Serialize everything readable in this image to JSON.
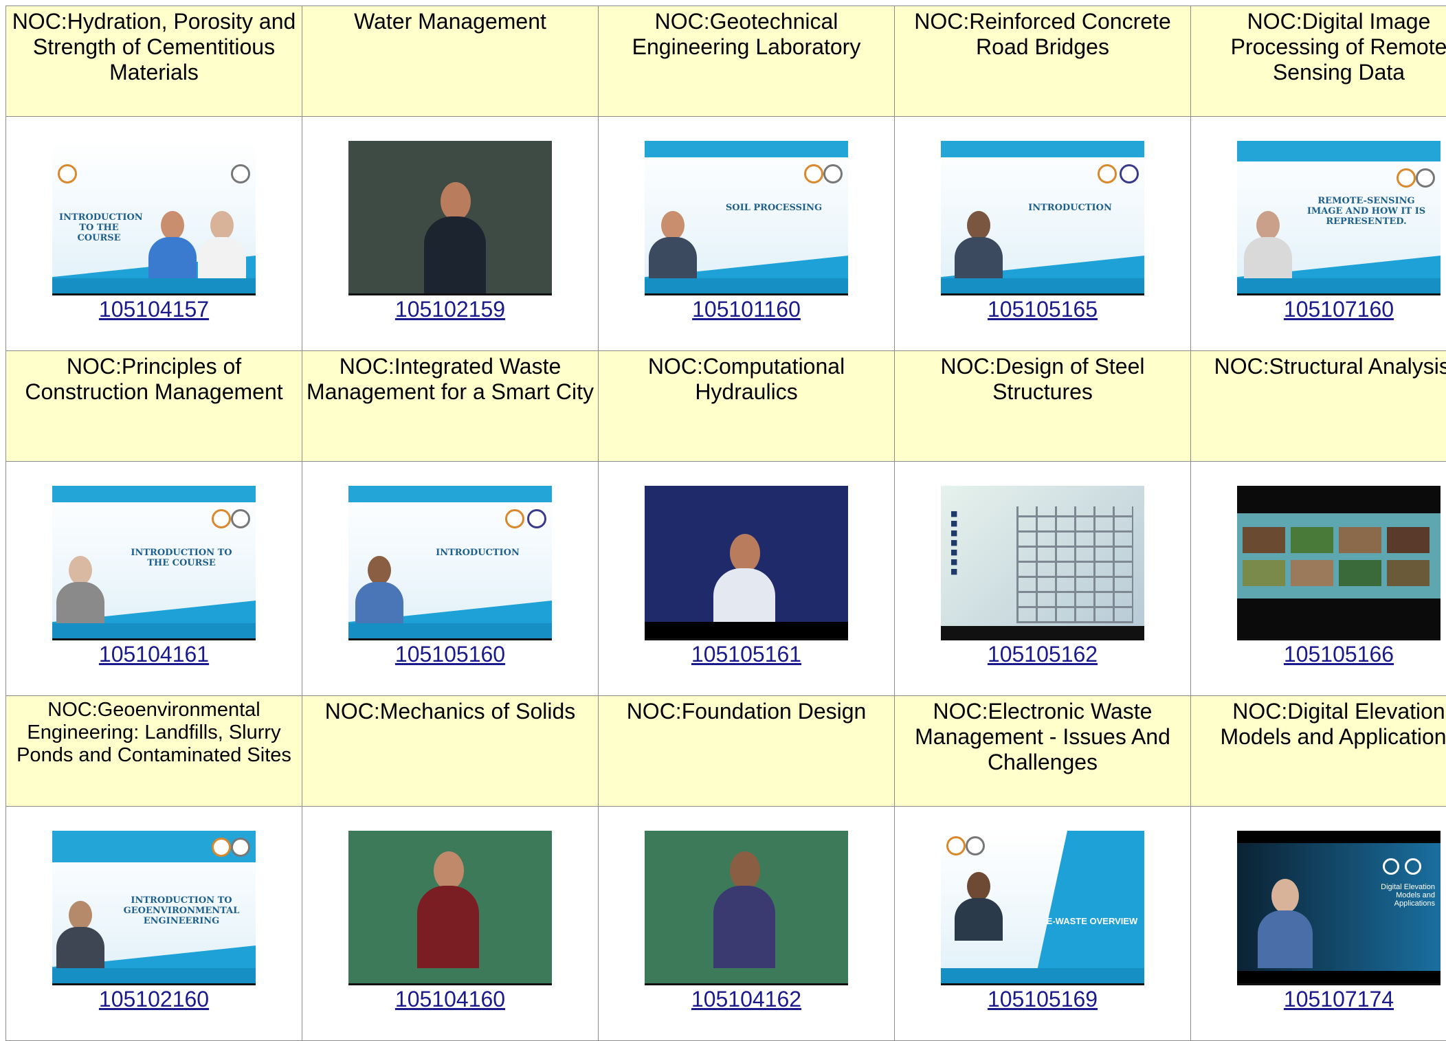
{
  "rows": [
    {
      "courses": [
        {
          "title": "NOC:Hydration, Porosity and Strength of Cementitious Materials",
          "code": "105104157",
          "thumb_text": "INTRODUCTION TO THE COURSE"
        },
        {
          "title": "Water Management",
          "code": "105102159",
          "thumb_text": ""
        },
        {
          "title": "NOC:Geotechnical Engineering Laboratory",
          "code": "105101160",
          "thumb_text": "SOIL PROCESSING"
        },
        {
          "title": "NOC:Reinforced Concrete Road Bridges",
          "code": "105105165",
          "thumb_text": "INTRODUCTION"
        },
        {
          "title": "NOC:Digital Image Processing of Remote Sensing Data",
          "code": "105107160",
          "thumb_text": "REMOTE-SENSING IMAGE AND HOW IT IS REPRESENTED."
        }
      ]
    },
    {
      "courses": [
        {
          "title": "NOC:Principles of Construction Management",
          "code": "105104161",
          "thumb_text": "INTRODUCTION TO THE COURSE"
        },
        {
          "title": "NOC:Integrated Waste Management for a Smart City",
          "code": "105105160",
          "thumb_text": "INTRODUCTION"
        },
        {
          "title": "NOC:Computational Hydraulics",
          "code": "105105161",
          "thumb_text": ""
        },
        {
          "title": "NOC:Design of Steel Structures",
          "code": "105105162",
          "thumb_text": ""
        },
        {
          "title": "NOC:Structural Analysis-I",
          "code": "105105166",
          "thumb_text": ""
        }
      ]
    },
    {
      "courses": [
        {
          "title": "NOC:Geoenvironmental Engineering: Landfills, Slurry Ponds and Contaminated Sites",
          "code": "105102160",
          "thumb_text": "INTRODUCTION TO GEOENVIRONMENTAL ENGINEERING"
        },
        {
          "title": "NOC:Mechanics of Solids",
          "code": "105104160",
          "thumb_text": ""
        },
        {
          "title": "NOC:Foundation Design",
          "code": "105104162",
          "thumb_text": ""
        },
        {
          "title": "NOC:Electronic Waste Management - Issues And Challenges",
          "code": "105105169",
          "thumb_text": "E-WASTE OVERVIEW"
        },
        {
          "title": "NOC:Digital Elevation Models and Applications",
          "code": "105107174",
          "thumb_text": "Digital Elevation Models and Applications"
        }
      ]
    }
  ],
  "colors": {
    "title_bg": "#ffffcc",
    "link": "#1a1a8c",
    "slide_accent": "#1ea1d6",
    "border": "#8c8c8c"
  }
}
